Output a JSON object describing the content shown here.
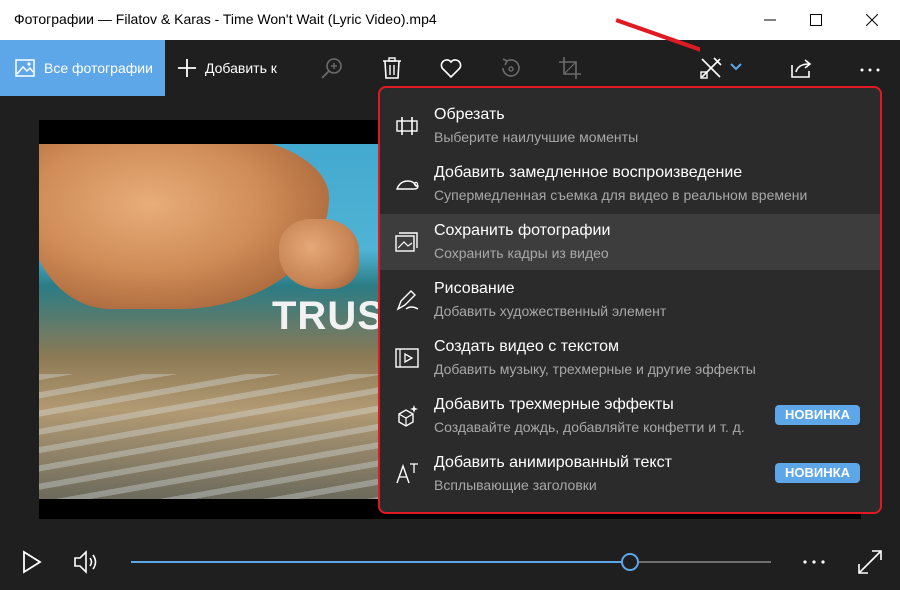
{
  "window": {
    "title": "Фотографии — Filatov & Karas - Time Won't Wait (Lyric Video).mp4"
  },
  "toolbar": {
    "all_photos_label": "Все фотографии",
    "add_label": "Добавить к",
    "icons": [
      "zoom-icon",
      "delete-icon",
      "favorite-icon",
      "rotate-icon",
      "crop-icon",
      "edit-create-icon",
      "chevron-down-icon",
      "share-icon",
      "more-icon"
    ]
  },
  "video": {
    "overlay_text": "TRUS"
  },
  "playback": {
    "progress": 0.78
  },
  "menu": {
    "items": [
      {
        "title": "Обрезать",
        "subtitle": "Выберите наилучшие моменты",
        "icon": "trim-icon",
        "badge": ""
      },
      {
        "title": "Добавить замедленное воспроизведение",
        "subtitle": "Супермедленная съемка для видео в реальном времени",
        "icon": "slow-motion-icon",
        "badge": ""
      },
      {
        "title": "Сохранить фотографии",
        "subtitle": "Сохранить кадры из видео",
        "icon": "save-photos-icon",
        "badge": ""
      },
      {
        "title": "Рисование",
        "subtitle": "Добавить художественный элемент",
        "icon": "draw-icon",
        "badge": ""
      },
      {
        "title": "Создать видео с текстом",
        "subtitle": "Добавить музыку, трехмерные и другие эффекты",
        "icon": "video-text-icon",
        "badge": ""
      },
      {
        "title": "Добавить трехмерные эффекты",
        "subtitle": "Создавайте дождь, добавляйте конфетти и т. д.",
        "icon": "3d-effects-icon",
        "badge": "НОВИНКА"
      },
      {
        "title": "Добавить анимированный текст",
        "subtitle": "Всплывающие заголовки",
        "icon": "animated-text-icon",
        "badge": "НОВИНКА"
      }
    ]
  },
  "colors": {
    "accent": "#5da6e8",
    "highlight_border": "#e01a22",
    "menu_bg": "#2b2b2b",
    "app_bg": "#1f1f1f"
  }
}
